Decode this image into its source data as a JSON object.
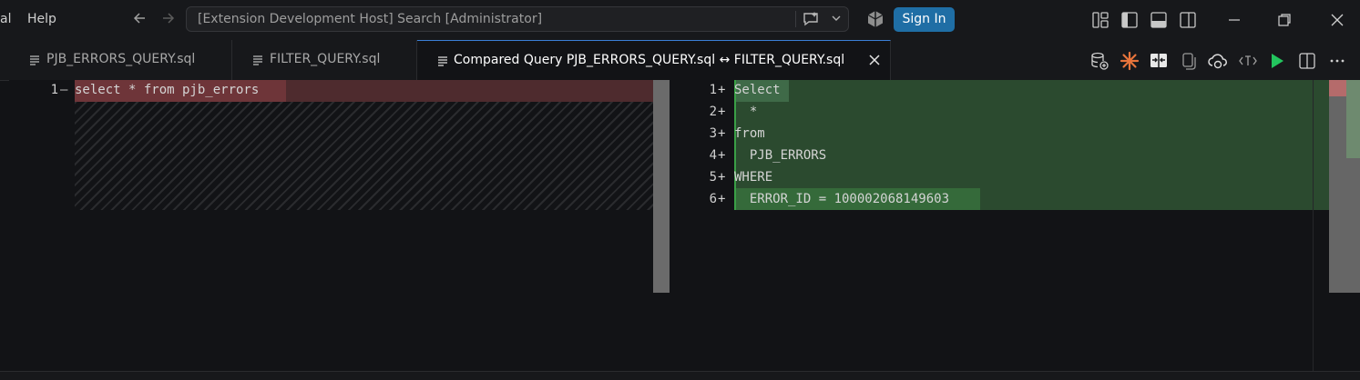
{
  "titlebar": {
    "menu": [
      "al",
      "Help"
    ],
    "search_text": "[Extension Development Host] Search [Administrator]",
    "sign_in_label": "Sign In",
    "icons": [
      "back-arrow-icon",
      "forward-arrow-icon",
      "chat-icon",
      "chevron-down-icon",
      "copilot-icon",
      "customize-layout-icon",
      "toggle-primary-sidebar-icon",
      "toggle-panel-icon",
      "toggle-secondary-sidebar-icon",
      "minimize-icon",
      "restore-icon",
      "close-icon"
    ]
  },
  "tabs": [
    {
      "label": "PJB_ERRORS_QUERY.sql",
      "active": false
    },
    {
      "label": "FILTER_QUERY.sql",
      "active": false
    },
    {
      "label": "Compared Query PJB_ERRORS_QUERY.sql ↔ FILTER_QUERY.sql",
      "active": true
    }
  ],
  "editor_actions": [
    "database-add-icon",
    "sparkle-icon",
    "compare-icon",
    "copy-icon",
    "cloud-sync-icon",
    "text-format-icon",
    "run-icon",
    "split-editor-icon",
    "more-icon"
  ],
  "left_editor": {
    "lines": [
      {
        "number": "1",
        "marker": "–",
        "text": "select * from pjb_errors"
      }
    ]
  },
  "right_editor": {
    "lines": [
      {
        "number": "1",
        "marker": "+",
        "text": "Select"
      },
      {
        "number": "2",
        "marker": "+",
        "text": "  *"
      },
      {
        "number": "3",
        "marker": "+",
        "text": "from"
      },
      {
        "number": "4",
        "marker": "+",
        "text": "  PJB_ERRORS"
      },
      {
        "number": "5",
        "marker": "+",
        "text": "WHERE"
      },
      {
        "number": "6",
        "marker": "+",
        "text": "  ERROR_ID = 100002068149603"
      }
    ]
  },
  "colors": {
    "accent": "#1f6ea5",
    "deleted_line": "#4e2b2e",
    "deleted_word": "#7a3c40",
    "inserted_line": "#2b4a2f",
    "run_green": "#23c55e"
  }
}
